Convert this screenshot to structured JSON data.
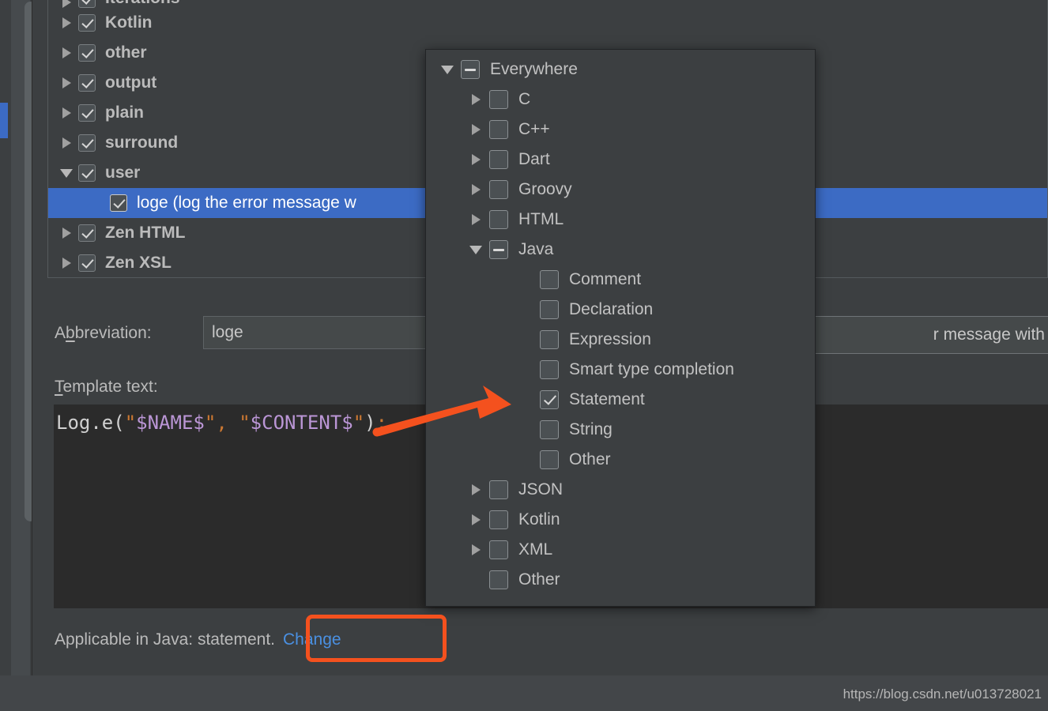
{
  "template_tree": {
    "rows": [
      {
        "label": "Iterations",
        "expanded": false,
        "checked": true,
        "level": 0,
        "clipped": true,
        "selected": false
      },
      {
        "label": "Kotlin",
        "expanded": false,
        "checked": true,
        "level": 0,
        "clipped": false,
        "selected": false
      },
      {
        "label": "other",
        "expanded": false,
        "checked": true,
        "level": 0,
        "clipped": false,
        "selected": false
      },
      {
        "label": "output",
        "expanded": false,
        "checked": true,
        "level": 0,
        "clipped": false,
        "selected": false
      },
      {
        "label": "plain",
        "expanded": false,
        "checked": true,
        "level": 0,
        "clipped": false,
        "selected": false
      },
      {
        "label": "surround",
        "expanded": false,
        "checked": true,
        "level": 0,
        "clipped": false,
        "selected": false
      },
      {
        "label": "user",
        "expanded": true,
        "checked": true,
        "level": 0,
        "clipped": false,
        "selected": false
      },
      {
        "label": "loge (log the error message w",
        "expanded": null,
        "checked": true,
        "level": 1,
        "clipped": false,
        "selected": true
      },
      {
        "label": "Zen HTML",
        "expanded": false,
        "checked": true,
        "level": 0,
        "clipped": false,
        "selected": false
      },
      {
        "label": "Zen XSL",
        "expanded": false,
        "checked": true,
        "level": 0,
        "clipped": false,
        "selected": false
      }
    ]
  },
  "form": {
    "abbreviation_label": "A",
    "abbreviation_label_accel": "b",
    "abbreviation_label_rest": "breviation:",
    "abbreviation_value": "loge",
    "description_value": "r message with tag",
    "template_text_label_accel": "T",
    "template_text_label_rest": "emplate text:",
    "template_code": {
      "segments": [
        {
          "text": "Log.e(",
          "kind": "plain"
        },
        {
          "text": "\"",
          "kind": "punct"
        },
        {
          "text": "$NAME$",
          "kind": "var"
        },
        {
          "text": "\"",
          "kind": "punct"
        },
        {
          "text": ",",
          "kind": "punct"
        },
        {
          "text": " ",
          "kind": "plain"
        },
        {
          "text": "\"",
          "kind": "punct"
        },
        {
          "text": "$CONTENT$",
          "kind": "var"
        },
        {
          "text": "\"",
          "kind": "punct"
        },
        {
          "text": ")",
          "kind": "plain"
        },
        {
          "text": ";",
          "kind": "punct"
        }
      ],
      "full_text": "Log.e(\"$NAME$\", \"$CONTENT$\");"
    },
    "applicable_text": "Applicable in Java: statement.",
    "change_link": "Change"
  },
  "context_popup": {
    "rows": [
      {
        "label": "Everywhere",
        "level": 0,
        "state": "indeterminate",
        "twisty": "down"
      },
      {
        "label": "C",
        "level": 1,
        "state": "unchecked",
        "twisty": "right"
      },
      {
        "label": "C++",
        "level": 1,
        "state": "unchecked",
        "twisty": "right"
      },
      {
        "label": "Dart",
        "level": 1,
        "state": "unchecked",
        "twisty": "right"
      },
      {
        "label": "Groovy",
        "level": 1,
        "state": "unchecked",
        "twisty": "right"
      },
      {
        "label": "HTML",
        "level": 1,
        "state": "unchecked",
        "twisty": "right"
      },
      {
        "label": "Java",
        "level": 1,
        "state": "indeterminate",
        "twisty": "down"
      },
      {
        "label": "Comment",
        "level": 2,
        "state": "unchecked",
        "twisty": "none"
      },
      {
        "label": "Declaration",
        "level": 2,
        "state": "unchecked",
        "twisty": "none"
      },
      {
        "label": "Expression",
        "level": 2,
        "state": "unchecked",
        "twisty": "none"
      },
      {
        "label": "Smart type completion",
        "level": 2,
        "state": "unchecked",
        "twisty": "none"
      },
      {
        "label": "Statement",
        "level": 2,
        "state": "checked",
        "twisty": "none"
      },
      {
        "label": "String",
        "level": 2,
        "state": "unchecked",
        "twisty": "none"
      },
      {
        "label": "Other",
        "level": 2,
        "state": "unchecked",
        "twisty": "none"
      },
      {
        "label": "JSON",
        "level": 1,
        "state": "unchecked",
        "twisty": "right"
      },
      {
        "label": "Kotlin",
        "level": 1,
        "state": "unchecked",
        "twisty": "right"
      },
      {
        "label": "XML",
        "level": 1,
        "state": "unchecked",
        "twisty": "right"
      },
      {
        "label": "Other",
        "level": 1,
        "state": "unchecked",
        "twisty": "none"
      }
    ]
  },
  "annotations": {
    "arrow_color": "#f4511e",
    "highlight_box_color": "#f4511e"
  },
  "footer": {
    "url": "https://blog.csdn.net/u013728021"
  },
  "colors": {
    "background": "#3c3f41",
    "selection_blue": "#3c6bc4",
    "editor_background": "#2b2b2b",
    "link_blue": "#4a90e2",
    "variable_purple": "#bb96d6",
    "punctuation_orange": "#cc7832"
  }
}
